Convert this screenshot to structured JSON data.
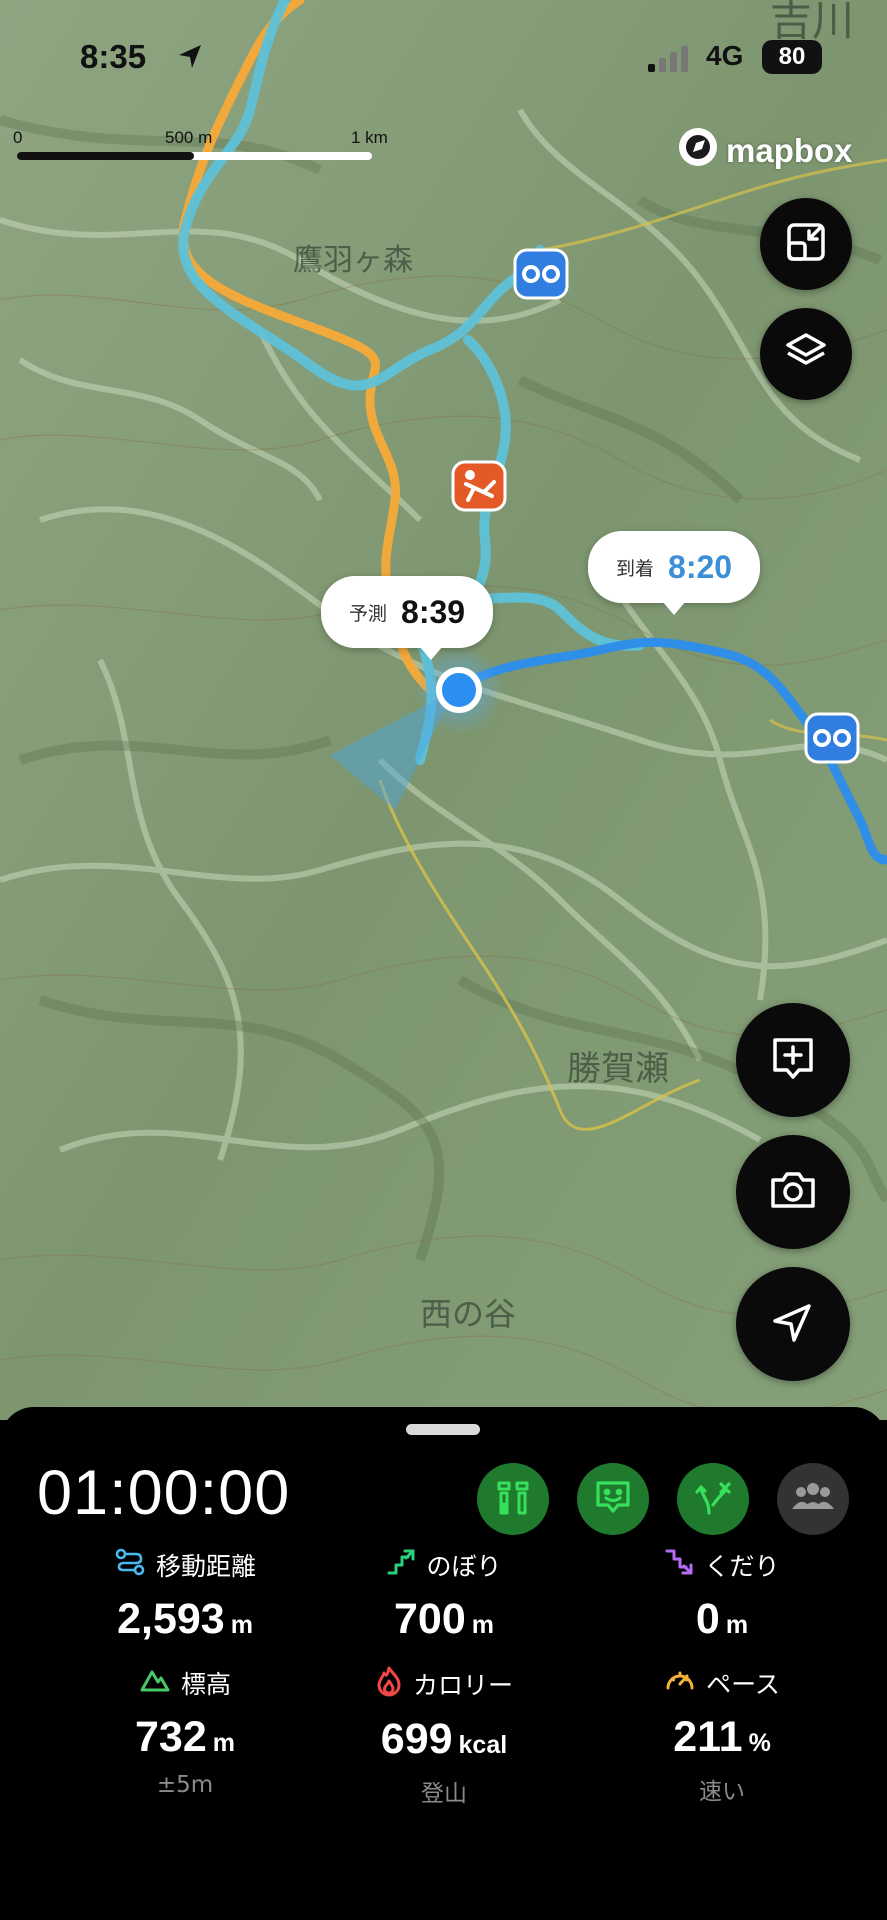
{
  "status_bar": {
    "time": "8:35",
    "network": "4G",
    "battery": "80"
  },
  "map": {
    "scale": {
      "zero": "0",
      "mid": "500 m",
      "end": "1 km"
    },
    "attribution": "mapbox",
    "place_labels": [
      "吉川",
      "鷹羽ヶ森",
      "勝賀瀬",
      "西の谷"
    ],
    "callouts": {
      "predicted": {
        "label": "予測",
        "value": "8:39"
      },
      "arrival": {
        "label": "到着",
        "value": "8:20"
      }
    },
    "colors": {
      "route_done": "#2f8ee8",
      "route_plan": "#5ec1d8",
      "trail": "#f2a93b",
      "accent_orange": "#e35a27",
      "poi_blue": "#2f7ee0"
    }
  },
  "map_buttons": [
    "collapse-icon",
    "layers-icon",
    "add-memo-icon",
    "camera-icon",
    "navigation-arrow-icon"
  ],
  "panel": {
    "elapsed": "01:00:00",
    "action_icons": [
      "route-trail-icon",
      "chat-face-icon",
      "route-branch-icon",
      "group-icon"
    ],
    "stats": [
      {
        "label": "移動距離",
        "value": "2,593",
        "unit": "m",
        "icon": "distance-icon",
        "color": "#49b9f0"
      },
      {
        "label": "のぼり",
        "value": "700",
        "unit": "m",
        "icon": "ascent-icon",
        "color": "#2bd07b"
      },
      {
        "label": "くだり",
        "value": "0",
        "unit": "m",
        "icon": "descent-icon",
        "color": "#b46cf7"
      },
      {
        "label": "標高",
        "value": "732",
        "unit": "m",
        "sub": "±5m",
        "icon": "elevation-icon",
        "color": "#47c968"
      },
      {
        "label": "カロリー",
        "value": "699",
        "unit": "kcal",
        "sub": "登山",
        "icon": "calorie-icon",
        "color": "#f04848"
      },
      {
        "label": "ペース",
        "value": "211",
        "unit": "%",
        "sub": "速い",
        "icon": "pace-icon",
        "color": "#f2b23a"
      }
    ]
  }
}
